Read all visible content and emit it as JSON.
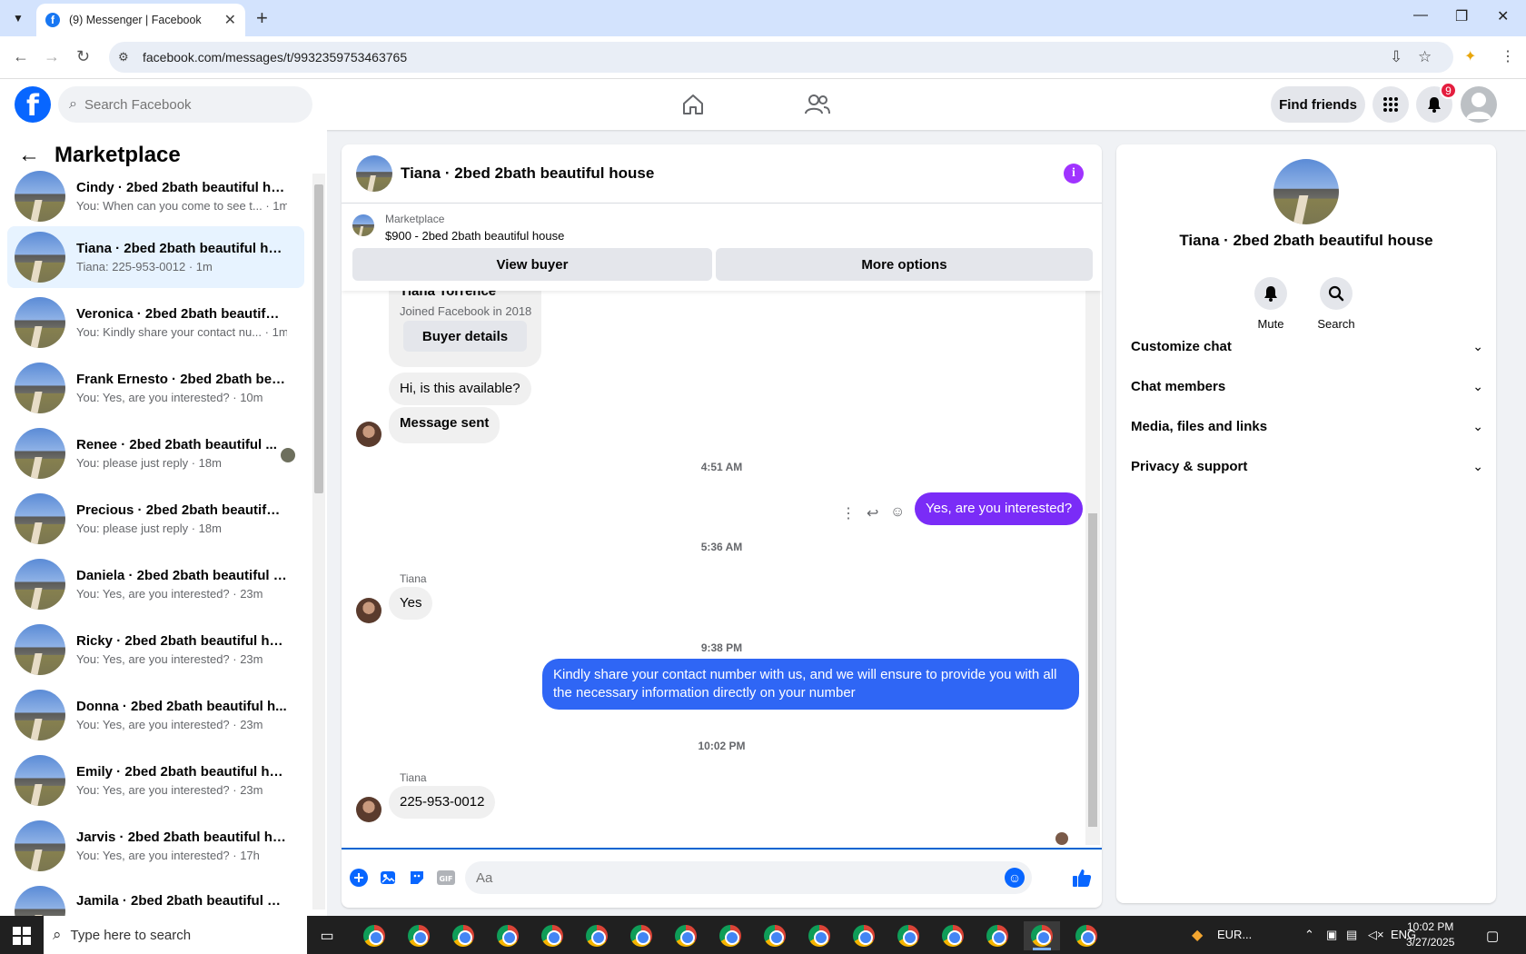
{
  "browser": {
    "tab_title": "(9) Messenger | Facebook",
    "url": "facebook.com/messages/t/9932359753463765"
  },
  "fb": {
    "search_placeholder": "Search Facebook",
    "find_friends": "Find friends",
    "notification_count": "9"
  },
  "left": {
    "title": "Marketplace",
    "conversations": [
      {
        "name": "Cindy · 2bed 2bath beautiful ho...",
        "sub": "You: When can you come to see t... · 1m",
        "active": false
      },
      {
        "name": "Tiana · 2bed 2bath beautiful ho...",
        "sub": "Tiana: 225-953-0012 · 1m",
        "active": true
      },
      {
        "name": "Veronica · 2bed 2bath beautiful ...",
        "sub": "You: Kindly share your contact nu... · 1m",
        "active": false
      },
      {
        "name": "Frank Ernesto · 2bed 2bath bea...",
        "sub": "You: Yes, are you interested? · 10m",
        "active": false
      },
      {
        "name": "Renee · 2bed 2bath beautiful ...",
        "sub": "You: please just reply · 18m",
        "active": false
      },
      {
        "name": "Precious · 2bed 2bath beautiful ...",
        "sub": "You: please just reply · 18m",
        "active": false
      },
      {
        "name": "Daniela · 2bed 2bath beautiful h...",
        "sub": "You: Yes, are you interested? · 23m",
        "active": false
      },
      {
        "name": "Ricky · 2bed 2bath beautiful ho...",
        "sub": "You: Yes, are you interested? · 23m",
        "active": false
      },
      {
        "name": "Donna · 2bed 2bath beautiful h...",
        "sub": "You: Yes, are you interested? · 23m",
        "active": false
      },
      {
        "name": "Emily · 2bed 2bath beautiful ho...",
        "sub": "You: Yes, are you interested? · 23m",
        "active": false
      },
      {
        "name": "Jarvis · 2bed 2bath beautiful ho...",
        "sub": "You: Yes, are you interested? · 17h",
        "active": false
      },
      {
        "name": "Jamila · 2bed 2bath beautiful ho...",
        "sub": "",
        "active": false
      }
    ]
  },
  "chat": {
    "title": "Tiana · 2bed 2bath beautiful house",
    "listing_label": "Marketplace",
    "listing_price": "$900 - 2bed 2bath beautiful house",
    "view_buyer": "View buyer",
    "more_options": "More options",
    "profile_name": "Tiana Torrence",
    "profile_joined": "Joined Facebook in 2018",
    "buyer_details": "Buyer details",
    "msg_available": "Hi, is this available?",
    "msg_sent": "Message sent",
    "time1": "4:51 AM",
    "msg_interested": "Yes, are you interested?",
    "time2": "5:36 AM",
    "sender": "Tiana",
    "msg_yes": "Yes",
    "time3": "9:38 PM",
    "msg_share": "Kindly share your contact number with us, and we will ensure to provide you with all the necessary information directly on your number",
    "time4": "10:02 PM",
    "msg_phone": "225-953-0012",
    "composer_placeholder": "Aa"
  },
  "right": {
    "title": "Tiana · 2bed 2bath beautiful house",
    "mute": "Mute",
    "search": "Search",
    "sections": [
      "Customize chat",
      "Chat members",
      "Media, files and links",
      "Privacy & support"
    ]
  },
  "taskbar": {
    "search_placeholder": "Type here to search",
    "weather": "EUR...",
    "lang": "ENG",
    "time": "10:02 PM",
    "date": "3/27/2025"
  }
}
